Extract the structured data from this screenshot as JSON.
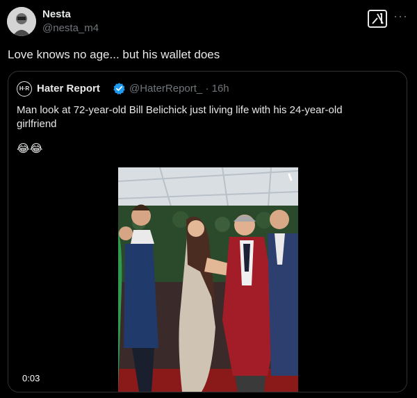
{
  "author": {
    "display_name": "Nesta",
    "handle": "@nesta_m4"
  },
  "post": {
    "text": "Love knows no age... but his wallet does"
  },
  "header_icons": {
    "grok": "grok-icon",
    "more": "more-options-icon"
  },
  "quote": {
    "avatar_text": "H·R",
    "display_name": "Hater Report",
    "handle_time": "@HaterReport_ · 16h",
    "text": "Man look at 72-year-old Bill Belichick just living life with his 24-year-old girlfriend",
    "emoji": "😂😂",
    "video": {
      "timestamp": "0:03"
    }
  },
  "colors": {
    "background": "#000000",
    "text": "#e7e9ea",
    "secondary": "#71767b",
    "border": "#2f3336",
    "verified": "#1d9bf0"
  }
}
